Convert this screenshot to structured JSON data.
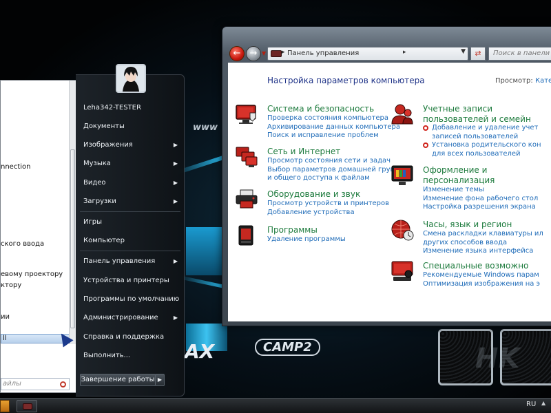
{
  "start_menu": {
    "programs": [
      "nnection",
      "ского ввода",
      "евому проектору",
      "ктору",
      "ии",
      "ll"
    ],
    "search_placeholder": "айлы",
    "user_name": "Leha342-TESTER",
    "items": [
      {
        "label": "Документы",
        "submenu": false
      },
      {
        "label": "Изображения",
        "submenu": true
      },
      {
        "label": "Музыка",
        "submenu": true
      },
      {
        "label": "Видео",
        "submenu": true
      },
      {
        "label": "Загрузки",
        "submenu": true
      },
      {
        "label": "Игры",
        "submenu": false
      },
      {
        "label": "Компьютер",
        "submenu": false
      },
      {
        "label": "Панель управления",
        "submenu": true
      },
      {
        "label": "Устройства и принтеры",
        "submenu": false
      },
      {
        "label": "Программы по умолчанию",
        "submenu": false
      },
      {
        "label": "Администрирование",
        "submenu": true
      },
      {
        "label": "Справка и поддержка",
        "submenu": false
      },
      {
        "label": "Выполнить...",
        "submenu": false
      }
    ],
    "shutdown_label": "Завершение работы"
  },
  "control_panel": {
    "address": "Панель управления",
    "search_placeholder": "Поиск в панели упр",
    "heading": "Настройка параметров компьютера",
    "view_label": "Просмотр:",
    "view_value": "Кате",
    "categories_left": [
      {
        "title": "Система и безопасность",
        "icon": "shield-computer-icon",
        "links": [
          "Проверка состояния компьютера",
          "Архивирование данных компьютера",
          "Поиск и исправление проблем"
        ]
      },
      {
        "title": "Сеть и Интернет",
        "icon": "network-icon",
        "links": [
          "Просмотр состояния сети и задач",
          "Выбор параметров домашней группы",
          "и общего доступа к файлам"
        ]
      },
      {
        "title": "Оборудование и звук",
        "icon": "printer-icon",
        "links": [
          "Просмотр устройств и принтеров",
          "Добавление устройства"
        ]
      },
      {
        "title": "Программы",
        "icon": "programs-icon",
        "links": [
          "Удаление программы"
        ]
      }
    ],
    "categories_right": [
      {
        "title": "Учетные записи",
        "title2": "пользователей и семейн",
        "icon": "user-accounts-icon",
        "links": [
          "Добавление и удаление учет",
          "записей пользователей",
          "Установка родительского кон",
          "для всех пользователей"
        ],
        "shield_links": [
          0,
          2
        ]
      },
      {
        "title": "Оформление и",
        "title2": "персонализация",
        "icon": "display-icon",
        "links": [
          "Изменение темы",
          "Изменение фона рабочего стол",
          "Настройка разрешения экрана"
        ],
        "shield_links": []
      },
      {
        "title": "Часы, язык и регион",
        "title2": "",
        "icon": "globe-clock-icon",
        "links": [
          "Смена раскладки клавиатуры ил",
          "других способов ввода",
          "Изменение языка интерфейса"
        ],
        "shield_links": []
      },
      {
        "title": "Специальные возможно",
        "title2": "",
        "icon": "accessibility-icon",
        "links": [
          "Рекомендуемые Windows парам",
          "Оптимизация изображения на э"
        ],
        "shield_links": []
      }
    ]
  },
  "wallpaper": {
    "text_www": "www",
    "text_max": "AX",
    "text_camp": "CAMP2",
    "text_hk": "HK"
  },
  "taskbar": {
    "language": "RU"
  },
  "colors": {
    "accent_green": "#1c7a3c",
    "link_blue": "#1e6bb8",
    "heading_blue": "#1e3287",
    "icon_red": "#c0241c"
  }
}
